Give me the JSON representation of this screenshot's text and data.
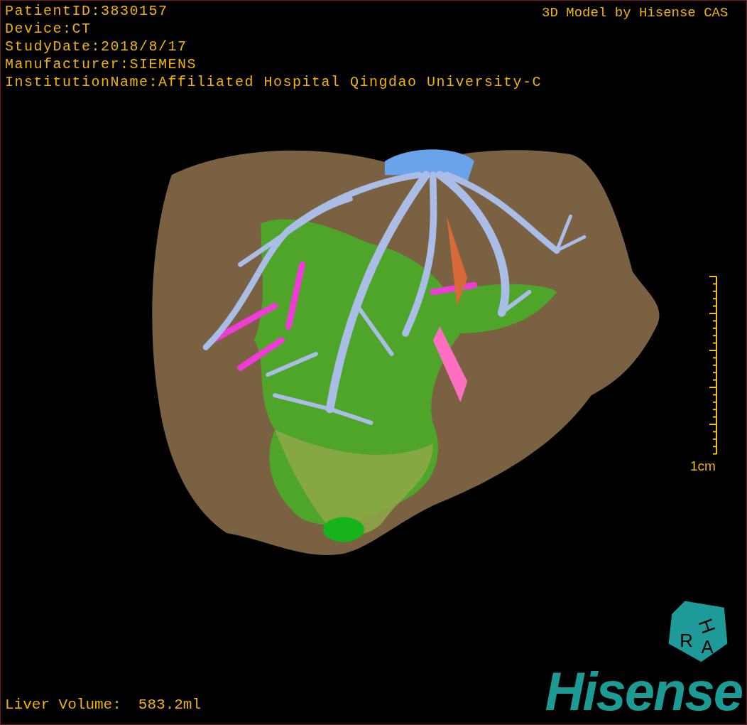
{
  "info_lines": [
    "PatientID:3830157",
    "Device:CT",
    "StudyDate:2018/8/17",
    "Manufacturer:SIEMENS",
    "InstitutionName:Affiliated Hospital Qingdao University-C"
  ],
  "title": "3D Model by Hisense CAS",
  "scale": {
    "label": "1cm"
  },
  "liver_volume": {
    "label": "Liver Volume:",
    "value": "583.2ml"
  },
  "orientation_cube": {
    "letters": [
      "H",
      "R",
      "A"
    ]
  },
  "logo": "Hisense"
}
